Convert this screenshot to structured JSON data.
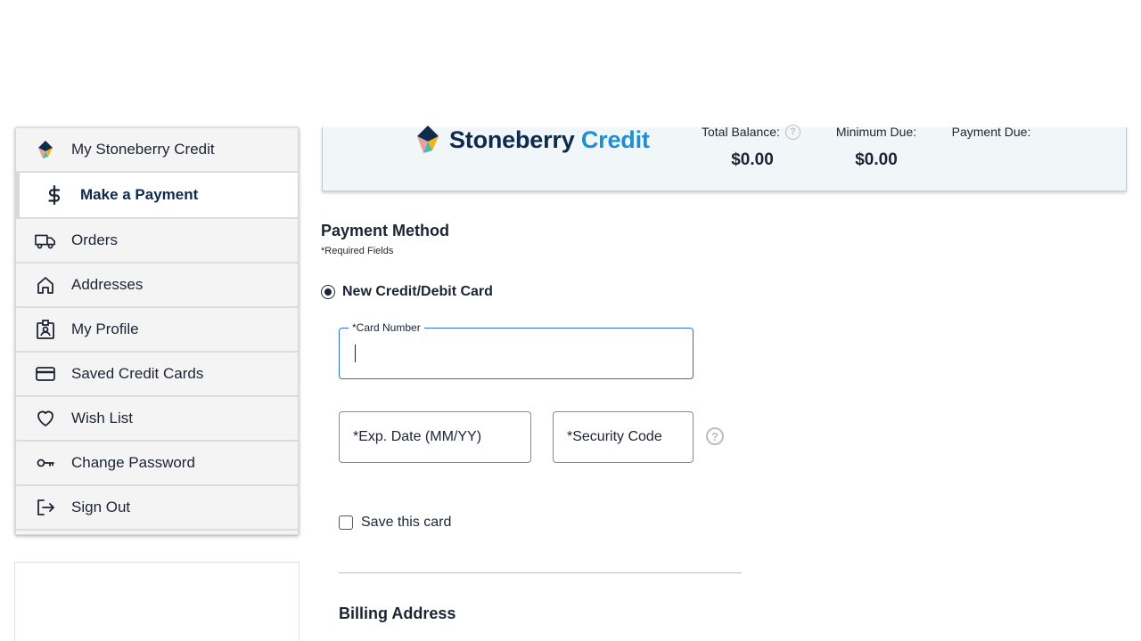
{
  "sidebar": {
    "items": [
      {
        "label": "My Stoneberry Credit",
        "icon": "stoneberry-logo-icon"
      },
      {
        "label": "Make a Payment",
        "icon": "dollar-icon",
        "active": true
      },
      {
        "label": "Orders",
        "icon": "truck-icon"
      },
      {
        "label": "Addresses",
        "icon": "home-icon"
      },
      {
        "label": "My Profile",
        "icon": "id-badge-icon"
      },
      {
        "label": "Saved Credit Cards",
        "icon": "credit-card-icon"
      },
      {
        "label": "Wish List",
        "icon": "heart-icon"
      },
      {
        "label": "Change Password",
        "icon": "key-icon"
      },
      {
        "label": "Sign Out",
        "icon": "sign-out-icon"
      }
    ]
  },
  "banner": {
    "logo_brand": "Stoneberry",
    "logo_credit": "Credit",
    "total_balance_label": "Total Balance:",
    "total_balance_value": "$0.00",
    "minimum_due_label": "Minimum Due:",
    "minimum_due_value": "$0.00",
    "payment_due_label": "Payment Due:",
    "payment_due_value": ""
  },
  "payment": {
    "title": "Payment Method",
    "required_note": "*Required Fields",
    "option_label": "New Credit/Debit Card",
    "card_number_label": "*Card Number",
    "card_number_value": "",
    "exp_date_placeholder": "*Exp. Date (MM/YY)",
    "security_code_placeholder": "*Security Code",
    "help_glyph": "?",
    "save_card_label": "Save this card"
  },
  "billing": {
    "title": "Billing Address"
  },
  "colors": {
    "brand_navy": "#0e2a4c",
    "brand_blue": "#1e8fd0",
    "focus_blue": "#2a6fd6",
    "banner_bg": "#f1f7f9"
  }
}
